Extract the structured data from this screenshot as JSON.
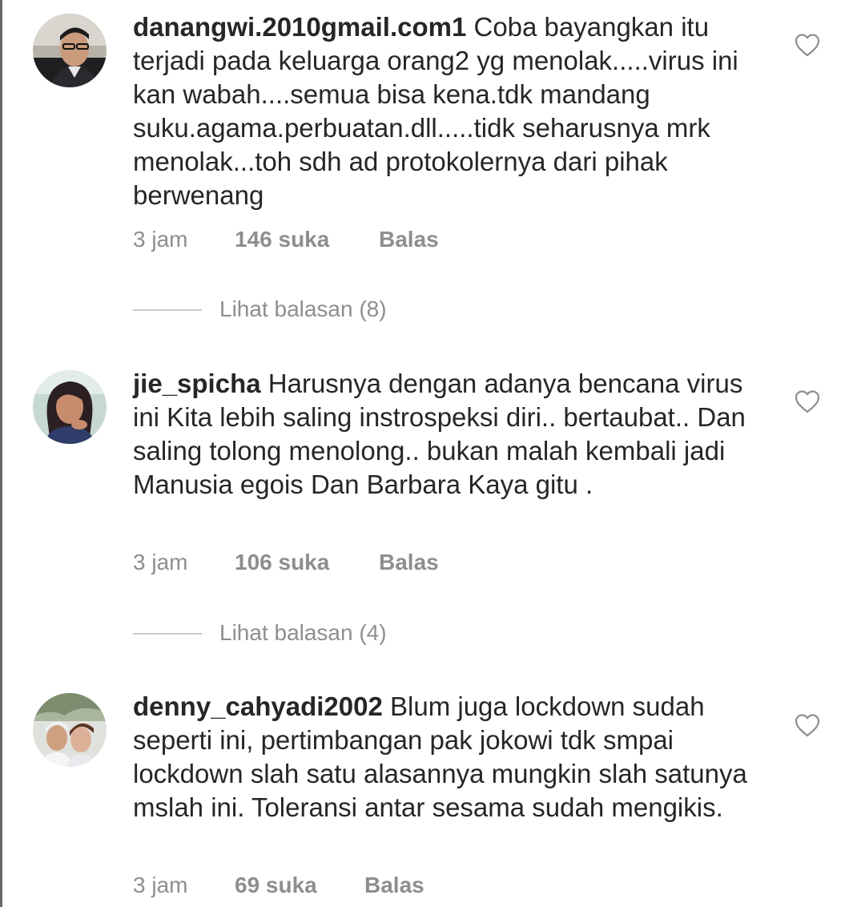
{
  "comments": [
    {
      "username": "danangwi.2010gmail.com1",
      "text": "Coba bayangkan itu terjadi pada keluarga orang2 yg menolak.....virus ini kan wabah....semua bisa kena.tdk mandang suku.agama.perbuatan.dll.....tidk seharusnya mrk menolak...toh sdh ad protokolernya dari pihak berwenang",
      "time": "3 jam",
      "likes": "146 suka",
      "reply_label": "Balas",
      "view_replies": "Lihat balasan (8)",
      "avatar_icon": "profile-photo-man-in-car"
    },
    {
      "username": "jie_spicha",
      "text": "Harusnya dengan adanya bencana virus ini Kita lebih saling instrospeksi diri.. bertaubat.. Dan saling tolong menolong.. bukan malah kembali jadi Manusia egois Dan Barbara Kaya gitu .",
      "time": "3 jam",
      "likes": "106 suka",
      "reply_label": "Balas",
      "view_replies": "Lihat balasan (4)",
      "avatar_icon": "profile-photo-woman"
    },
    {
      "username": "denny_cahyadi2002",
      "text": "Blum juga lockdown sudah seperti ini, pertimbangan pak jokowi tdk smpai lockdown slah satu alasannya mungkin slah satunya mslah ini. Toleransi antar sesama sudah mengikis.",
      "time": "3 jam",
      "likes": "69 suka",
      "reply_label": "Balas",
      "avatar_icon": "profile-photo-couple"
    }
  ],
  "icons": {
    "like": "heart-outline-icon"
  },
  "colors": {
    "text": "#262626",
    "secondary": "#8e8e8e",
    "divider": "#c7c7c7"
  }
}
